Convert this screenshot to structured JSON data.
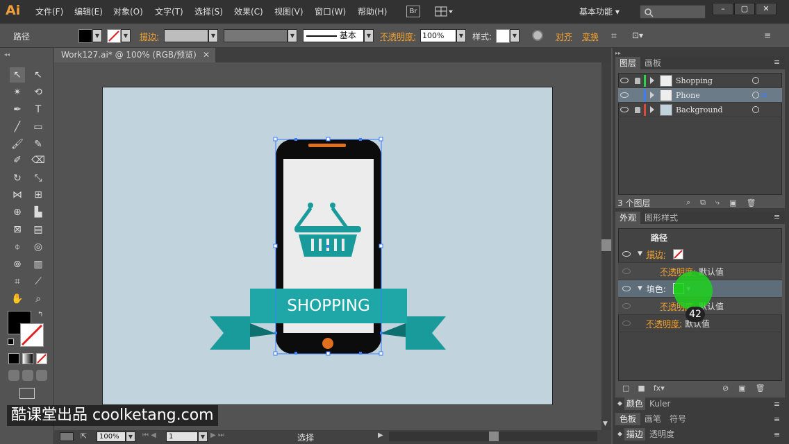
{
  "app": {
    "logo": "Ai"
  },
  "menu": [
    "文件(F)",
    "编辑(E)",
    "对象(O)",
    "文字(T)",
    "选择(S)",
    "效果(C)",
    "视图(V)",
    "窗口(W)",
    "帮助(H)"
  ],
  "menubar": {
    "bridge": "Br",
    "workspace": "基本功能"
  },
  "control": {
    "object_type": "路径",
    "stroke_label": "描边:",
    "basic_label": "基本",
    "opacity_label": "不透明度:",
    "opacity_value": "100%",
    "style_label": "样式:",
    "align_label": "对齐",
    "transform_label": "变换"
  },
  "document": {
    "tab_title": "Work127.ai* @ 100% (RGB/预览)"
  },
  "artwork": {
    "banner_text": "SHOPPING"
  },
  "status": {
    "zoom": "100%",
    "page": "1",
    "tool": "选择"
  },
  "watermark": "酷课堂出品 coolketang.com",
  "layers_panel": {
    "tabs": [
      "图层",
      "画板"
    ],
    "layers": [
      {
        "name": "Shopping",
        "color": "#2fd44a"
      },
      {
        "name": "Phone",
        "color": "#3a7dff"
      },
      {
        "name": "Background",
        "color": "#e04a3a"
      }
    ],
    "count": "3 个图层"
  },
  "appearance_panel": {
    "tabs": [
      "外观",
      "图形样式"
    ],
    "title": "路径",
    "stroke_label": "描边:",
    "opacity_label": "不透明度:",
    "default_value": "默认值",
    "fill_label": "填色:",
    "fill_color": "#1a9c1a"
  },
  "bottom_tabs": {
    "color": [
      "颜色",
      "Kuler"
    ],
    "swatches": [
      "色板",
      "画笔",
      "符号"
    ],
    "stroke": [
      "描边",
      "透明度"
    ]
  },
  "overlay": {
    "step_number": "42"
  },
  "colors": {
    "teal": "#1a9b9b",
    "orange": "#e07020",
    "accent_orange": "#f0a030"
  }
}
